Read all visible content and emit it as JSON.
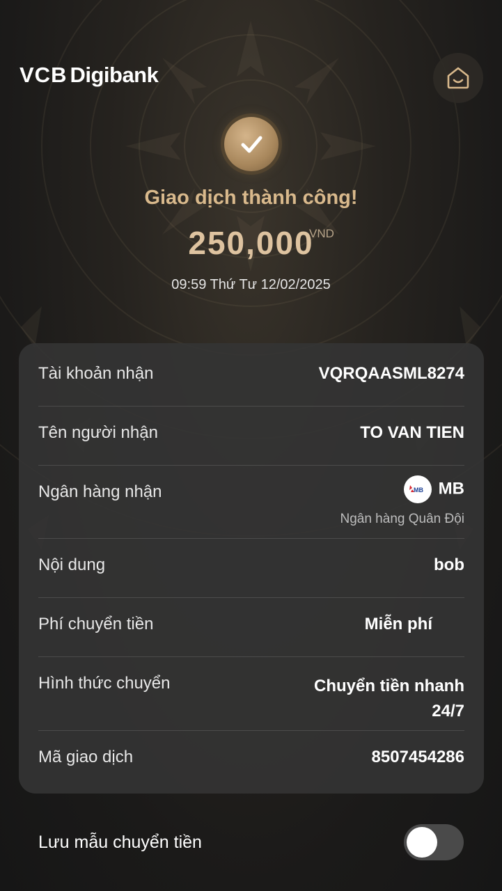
{
  "app": {
    "brand_vcb": "VCB",
    "brand_digi": "Digibank"
  },
  "transaction": {
    "status": "Giao dịch thành công!",
    "amount": "250,000",
    "currency": "VND",
    "datetime": "09:59 Thứ Tư 12/02/2025"
  },
  "details": {
    "account_label": "Tài khoản nhận",
    "account_value": "VQRQAASML8274",
    "recipient_label": "Tên người nhận",
    "recipient_value": "TO VAN TIEN",
    "bank_label": "Ngân hàng nhận",
    "bank_code": "MB",
    "bank_logo_text": "MB",
    "bank_name": "Ngân hàng Quân Đội",
    "content_label": "Nội dung",
    "content_value": "bob",
    "fee_label": "Phí chuyển tiền",
    "fee_value": "Miễn phí",
    "method_label": "Hình thức chuyển",
    "method_value_line1": "Chuyển tiền nhanh",
    "method_value_line2": "24/7",
    "txid_label": "Mã giao dịch",
    "txid_value": "8507454286"
  },
  "save_template": {
    "label": "Lưu mẫu chuyển tiền",
    "enabled": false
  },
  "colors": {
    "accent_gold": "#d9b98c",
    "card_bg": "#343434",
    "toggle_off": "#4a4a4a"
  },
  "icons": {
    "home": "home-smile-icon",
    "success": "checkmark-icon"
  }
}
